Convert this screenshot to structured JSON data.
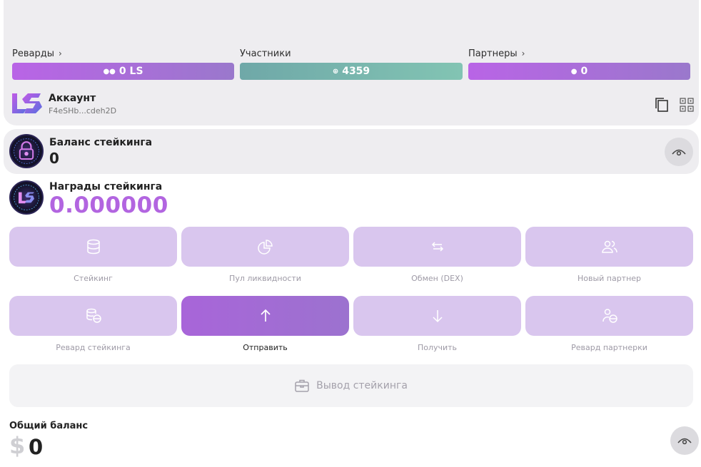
{
  "stats": {
    "rewards": {
      "label": "Реварды",
      "value": "0 LS"
    },
    "members": {
      "label": "Участники",
      "value": "4359"
    },
    "partners": {
      "label": "Партнеры",
      "value": "0"
    }
  },
  "account": {
    "title": "Аккаунт",
    "address": "F4eSHb...cdeh2D"
  },
  "staking_balance": {
    "title": "Баланс стейкинга",
    "value": "0"
  },
  "staking_rewards": {
    "title": "Награды стейкинга",
    "value": "0.000000"
  },
  "actions": [
    {
      "label": "Стейкинг",
      "icon": "database-icon"
    },
    {
      "label": "Пул ликвидности",
      "icon": "pie-chart-icon"
    },
    {
      "label": "Обмен (DEX)",
      "icon": "swap-arrows-icon"
    },
    {
      "label": "Новый партнер",
      "icon": "users-icon"
    },
    {
      "label": "Ревард стейкинга",
      "icon": "coins-icon"
    },
    {
      "label": "Отправить",
      "icon": "arrow-up-icon"
    },
    {
      "label": "Получить",
      "icon": "arrow-down-icon"
    },
    {
      "label": "Ревард партнерки",
      "icon": "user-coin-icon"
    }
  ],
  "withdraw": {
    "label": "Вывод стейкинга",
    "icon": "briefcase-icon"
  },
  "total": {
    "title": "Общий баланс",
    "currency": "$",
    "value": "0"
  },
  "colors": {
    "accent_purple": "#b265e0",
    "teal": "#7ab8ae",
    "tile_bg": "#d9c6ee",
    "card_bg": "#eeedf0"
  }
}
